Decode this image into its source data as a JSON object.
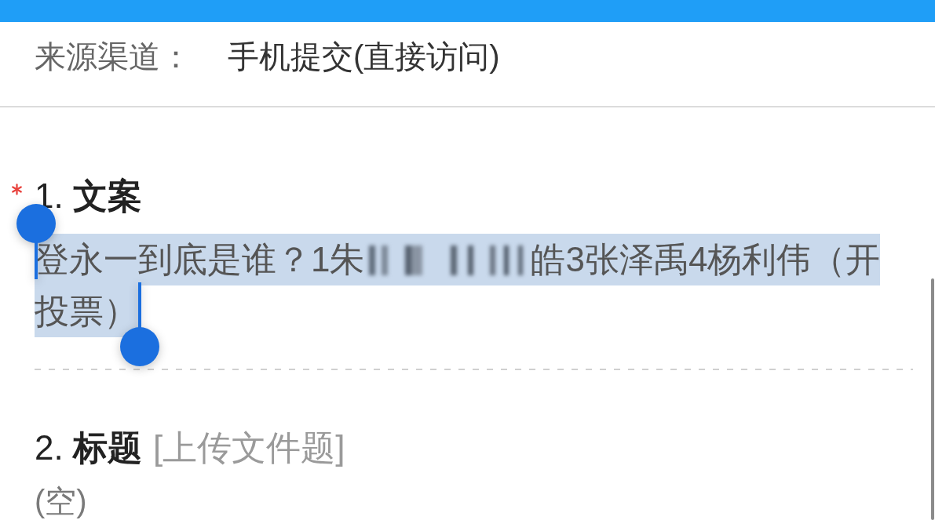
{
  "source": {
    "label": "来源渠道：",
    "value": "手机提交(直接访问)"
  },
  "questions": [
    {
      "required": true,
      "title": "1. **文案**",
      "answer": {
        "selected": true,
        "lines": [
          [
            {
              "kind": "text",
              "text": "登永一到底是谁？1朱"
            },
            {
              "kind": "redacted"
            },
            {
              "kind": "text",
              "text": "皓3张泽禹4杨利伟（开"
            }
          ],
          [
            {
              "kind": "text",
              "text": "投票）"
            }
          ]
        ]
      }
    },
    {
      "required": false,
      "title": "2. **标题**",
      "type_label": "[上传文件题]",
      "answer": {
        "selected": false,
        "lines": [
          [
            {
              "kind": "empty",
              "text": "(空)"
            }
          ]
        ]
      }
    }
  ]
}
